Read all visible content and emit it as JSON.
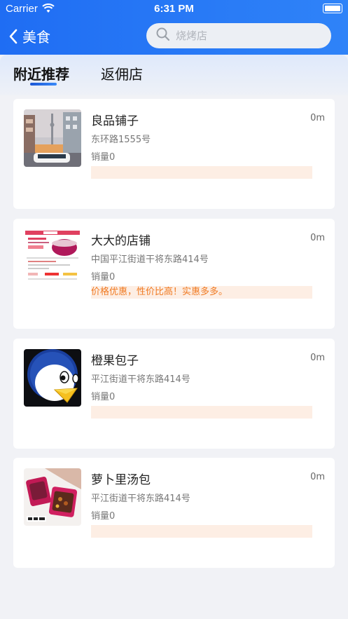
{
  "status_bar": {
    "carrier": "Carrier",
    "time": "6:31 PM"
  },
  "nav": {
    "back_label": "美食",
    "search_placeholder": "烧烤店"
  },
  "tabs": [
    {
      "label": "附近推荐",
      "active": true
    },
    {
      "label": "返佣店",
      "active": false
    }
  ],
  "colors": {
    "accent": "#1f6df3",
    "promo_text": "#f07a22",
    "promo_bg": "#fdeee4"
  },
  "shops": [
    {
      "name": "良品铺子",
      "distance": "0m",
      "address": "东环路1555号",
      "sales": "销量0",
      "promo": "",
      "thumb": "street-photo"
    },
    {
      "name": "大大的店铺",
      "distance": "0m",
      "address": "中国平江街道干将东路414号",
      "sales": "销量0",
      "promo": "价格优惠，性价比高！实惠多多。",
      "thumb": "product-page"
    },
    {
      "name": "橙果包子",
      "distance": "0m",
      "address": "平江街道干将东路414号",
      "sales": "销量0",
      "promo": "",
      "thumb": "penguin-logo"
    },
    {
      "name": "萝卜里汤包",
      "distance": "0m",
      "address": "平江街道干将东路414号",
      "sales": "销量0",
      "promo": "",
      "thumb": "food-packages"
    }
  ]
}
